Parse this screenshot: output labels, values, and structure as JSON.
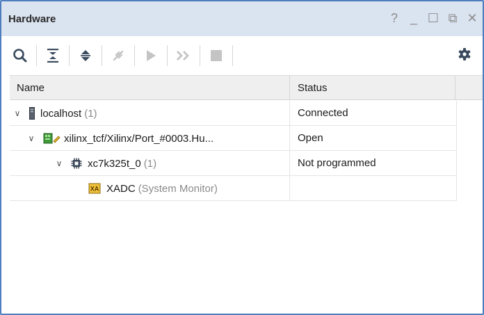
{
  "panel": {
    "title": "Hardware",
    "controls": [
      "?",
      "_",
      "☐",
      "⧉",
      "✕"
    ]
  },
  "toolbar": {
    "icons": [
      "search-icon",
      "collapse-all-icon",
      "expand-all-icon",
      "auto-connect-icon",
      "run-icon",
      "skip-icon",
      "stop-icon",
      "settings-icon"
    ]
  },
  "table": {
    "columns": {
      "name": "Name",
      "status": "Status"
    },
    "rows": [
      {
        "label": "localhost",
        "count": "(1)",
        "status": "Connected"
      },
      {
        "label": "xilinx_tcf/Xilinx/Port_#0003.Hu...",
        "count": "",
        "status": "Open"
      },
      {
        "label": "xc7k325t_0",
        "count": "(1)",
        "status": "Not programmed"
      },
      {
        "label": "XADC",
        "count": "(System Monitor)",
        "status": ""
      }
    ]
  }
}
